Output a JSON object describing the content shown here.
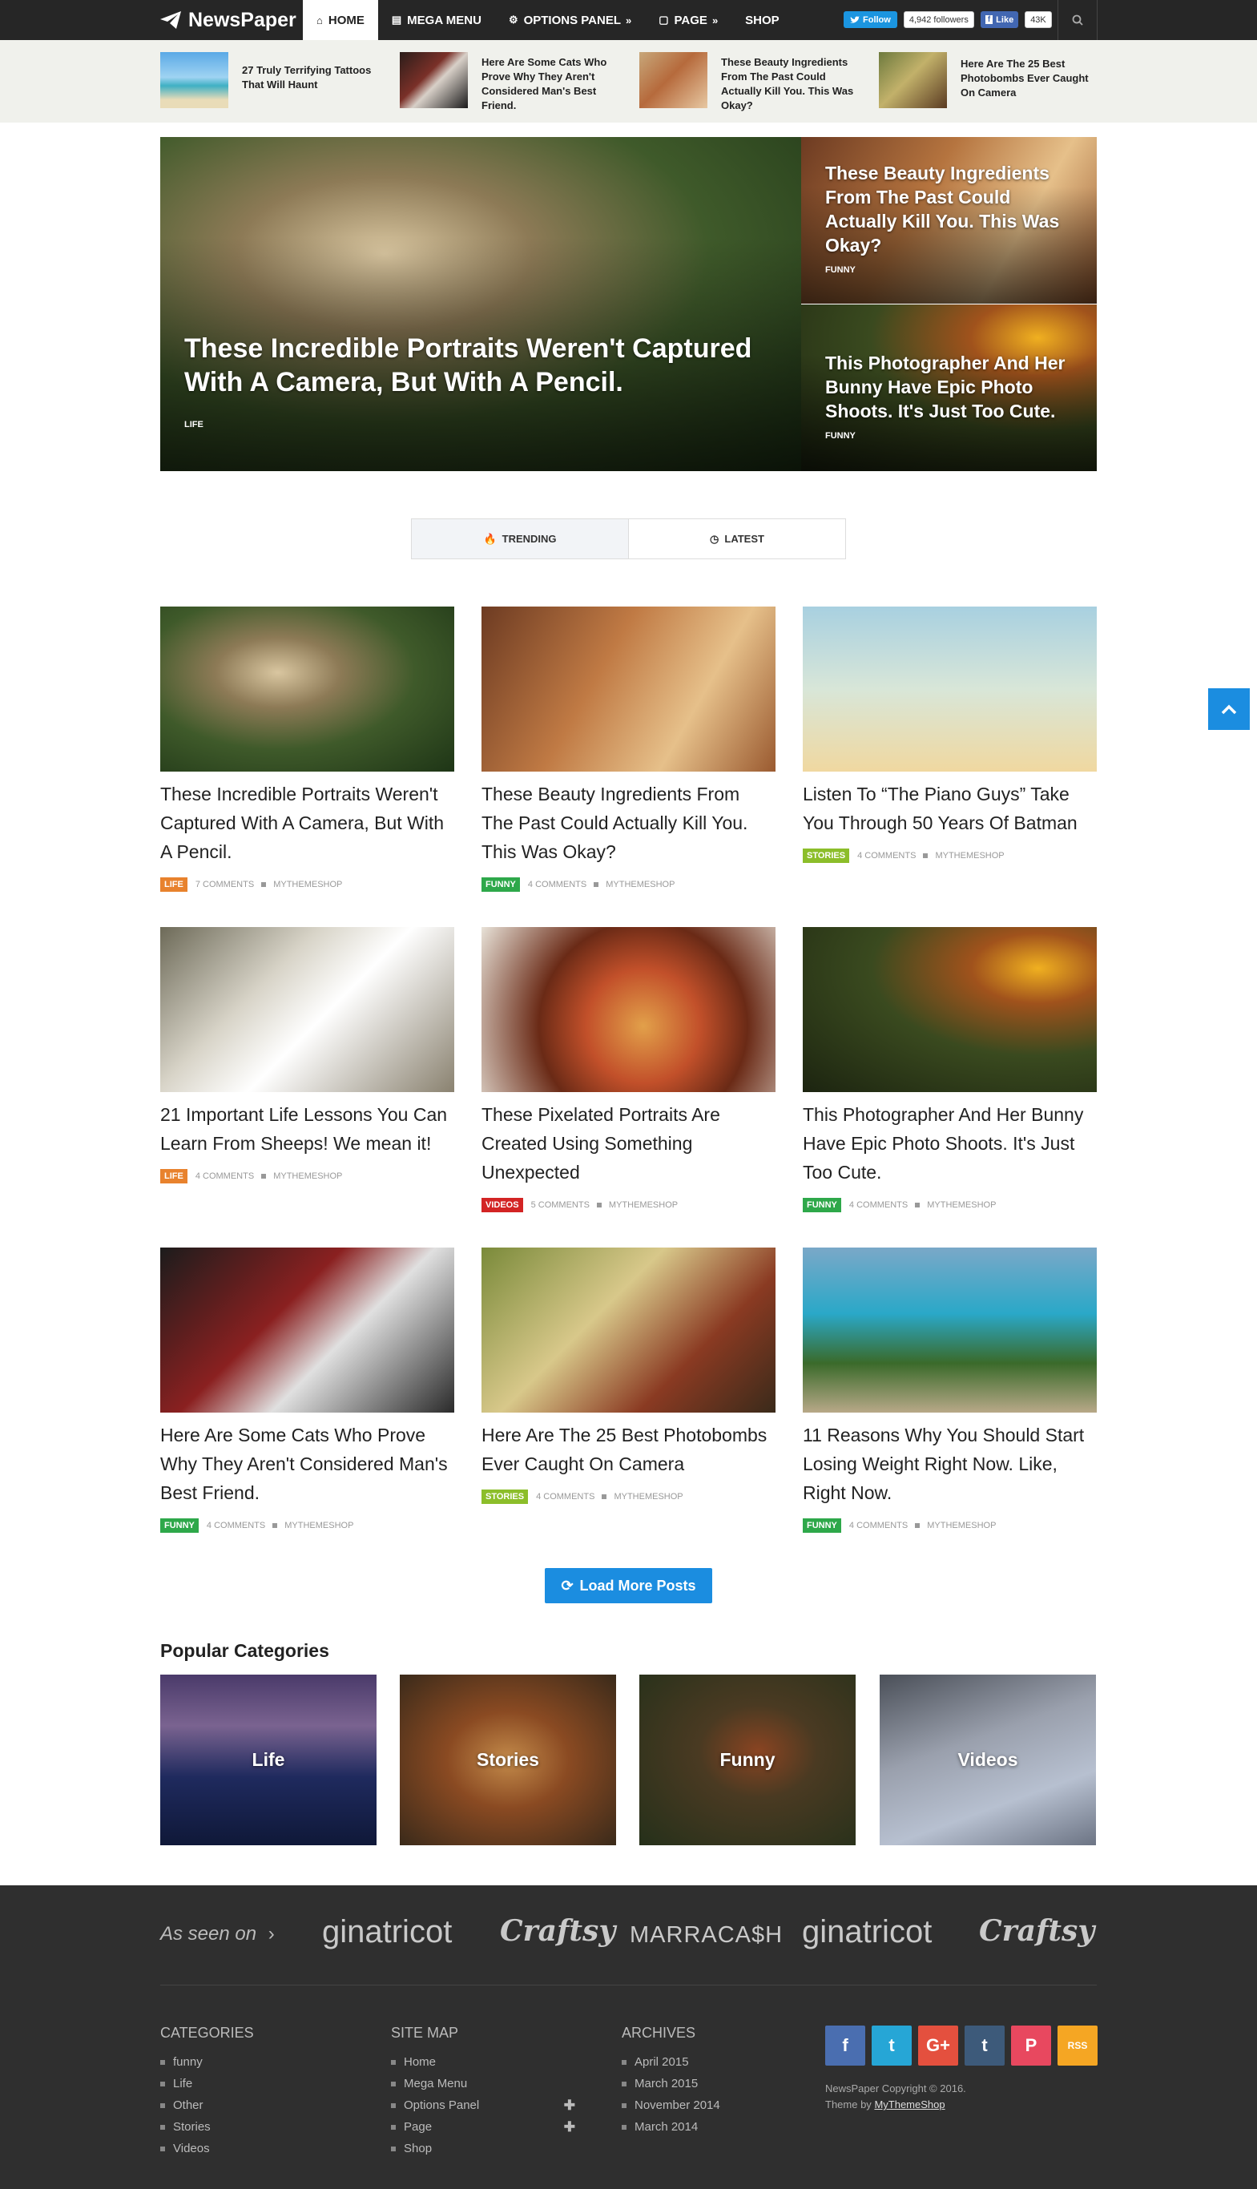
{
  "header": {
    "logo": "NewsPaper",
    "nav": [
      {
        "label": "HOME",
        "icon": "home-icon"
      },
      {
        "label": "MEGA MENU",
        "icon": "grid-icon"
      },
      {
        "label": "OPTIONS PANEL",
        "icon": "gear-icon"
      },
      {
        "label": "PAGE",
        "icon": "page-icon"
      },
      {
        "label": "SHOP",
        "icon": ""
      }
    ],
    "twitter_label": "Follow",
    "twitter_count": "4,942 followers",
    "facebook_label": "Like",
    "facebook_count": "43K"
  },
  "ticker": [
    {
      "title": "27 Truly Terrifying Tattoos That Will Haunt"
    },
    {
      "title": "Here Are Some Cats Who Prove Why They Aren't Considered Man's Best Friend."
    },
    {
      "title": "These Beauty Ingredients From The Past Could Actually Kill You. This Was Okay?"
    },
    {
      "title": "Here Are The 25 Best Photobombs Ever Caught On Camera"
    }
  ],
  "hero": {
    "main": {
      "title": "These Incredible Portraits Weren't Captured With A Camera, But With A Pencil.",
      "category": "LIFE"
    },
    "side": [
      {
        "title": "These Beauty Ingredients From The Past Could Actually Kill You. This Was Okay?",
        "category": "FUNNY"
      },
      {
        "title": "This Photographer And Her Bunny Have Epic Photo Shoots. It's Just Too Cute.",
        "category": "FUNNY"
      }
    ]
  },
  "tabs": {
    "trending": "TRENDING",
    "latest": "LATEST"
  },
  "posts": [
    {
      "title": "These Incredible Portraits Weren't Captured With A Camera, But With A Pencil.",
      "category": "LIFE",
      "cat_color": "#e8822d",
      "comments": "7 COMMENTS",
      "author": "MYTHEMESHOP"
    },
    {
      "title": "These Beauty Ingredients From The Past Could Actually Kill You. This Was Okay?",
      "category": "FUNNY",
      "cat_color": "#2ea84a",
      "comments": "4 COMMENTS",
      "author": "MYTHEMESHOP"
    },
    {
      "title": "Listen To “The Piano Guys” Take You Through 50 Years Of Batman",
      "category": "STORIES",
      "cat_color": "#8cbe2a",
      "comments": "4 COMMENTS",
      "author": "MYTHEMESHOP"
    },
    {
      "title": "21 Important Life Lessons You Can Learn From Sheeps! We mean it!",
      "category": "LIFE",
      "cat_color": "#e8822d",
      "comments": "4 COMMENTS",
      "author": "MYTHEMESHOP"
    },
    {
      "title": "These Pixelated Portraits Are Created Using Something Unexpected",
      "category": "VIDEOS",
      "cat_color": "#d32424",
      "comments": "5 COMMENTS",
      "author": "MYTHEMESHOP"
    },
    {
      "title": "This Photographer And Her Bunny Have Epic Photo Shoots. It's Just Too Cute.",
      "category": "FUNNY",
      "cat_color": "#2ea84a",
      "comments": "4 COMMENTS",
      "author": "MYTHEMESHOP"
    },
    {
      "title": "Here Are Some Cats Who Prove Why They Aren't Considered Man's Best Friend.",
      "category": "FUNNY",
      "cat_color": "#2ea84a",
      "comments": "4 COMMENTS",
      "author": "MYTHEMESHOP"
    },
    {
      "title": "Here Are The 25 Best Photobombs Ever Caught On Camera",
      "category": "STORIES",
      "cat_color": "#8cbe2a",
      "comments": "4 COMMENTS",
      "author": "MYTHEMESHOP"
    },
    {
      "title": "11 Reasons Why You Should Start Losing Weight Right Now. Like, Right Now.",
      "category": "FUNNY",
      "cat_color": "#2ea84a",
      "comments": "4 COMMENTS",
      "author": "MYTHEMESHOP"
    }
  ],
  "load_more": "Load More Posts",
  "popular": {
    "heading": "Popular Categories",
    "items": [
      "Life",
      "Stories",
      "Funny",
      "Videos"
    ]
  },
  "footer": {
    "seen_on": "As seen on",
    "brands": [
      "ginatricot",
      "Craftsy",
      "MARRACA$H",
      "ginatricot",
      "Craftsy"
    ],
    "categories": {
      "heading": "CATEGORIES",
      "items": [
        "funny",
        "Life",
        "Other",
        "Stories",
        "Videos"
      ]
    },
    "sitemap": {
      "heading": "SITE MAP",
      "items": [
        "Home",
        "Mega Menu",
        "Options Panel",
        "Page",
        "Shop"
      ]
    },
    "archives": {
      "heading": "ARCHIVES",
      "items": [
        "April 2015",
        "March 2015",
        "November 2014",
        "March 2014"
      ]
    },
    "social": [
      {
        "icon": "facebook-icon",
        "glyph": "f",
        "color": "#4a6eb0"
      },
      {
        "icon": "twitter-icon",
        "glyph": "t",
        "color": "#26a6d6"
      },
      {
        "icon": "google-plus-icon",
        "glyph": "G+",
        "color": "#e4503e"
      },
      {
        "icon": "tumblr-icon",
        "glyph": "t",
        "color": "#3d5a7a"
      },
      {
        "icon": "pinterest-icon",
        "glyph": "P",
        "color": "#e8485f"
      },
      {
        "icon": "rss-icon",
        "glyph": "RSS",
        "color": "#f5a623"
      }
    ],
    "copyright": "NewsPaper Copyright © 2016.",
    "theme_by": "Theme by",
    "theme_link": "MyThemeShop"
  },
  "colors": {
    "accent": "#1b8de0",
    "header_bg": "#262626",
    "footer_bg": "#2f2f2f"
  }
}
